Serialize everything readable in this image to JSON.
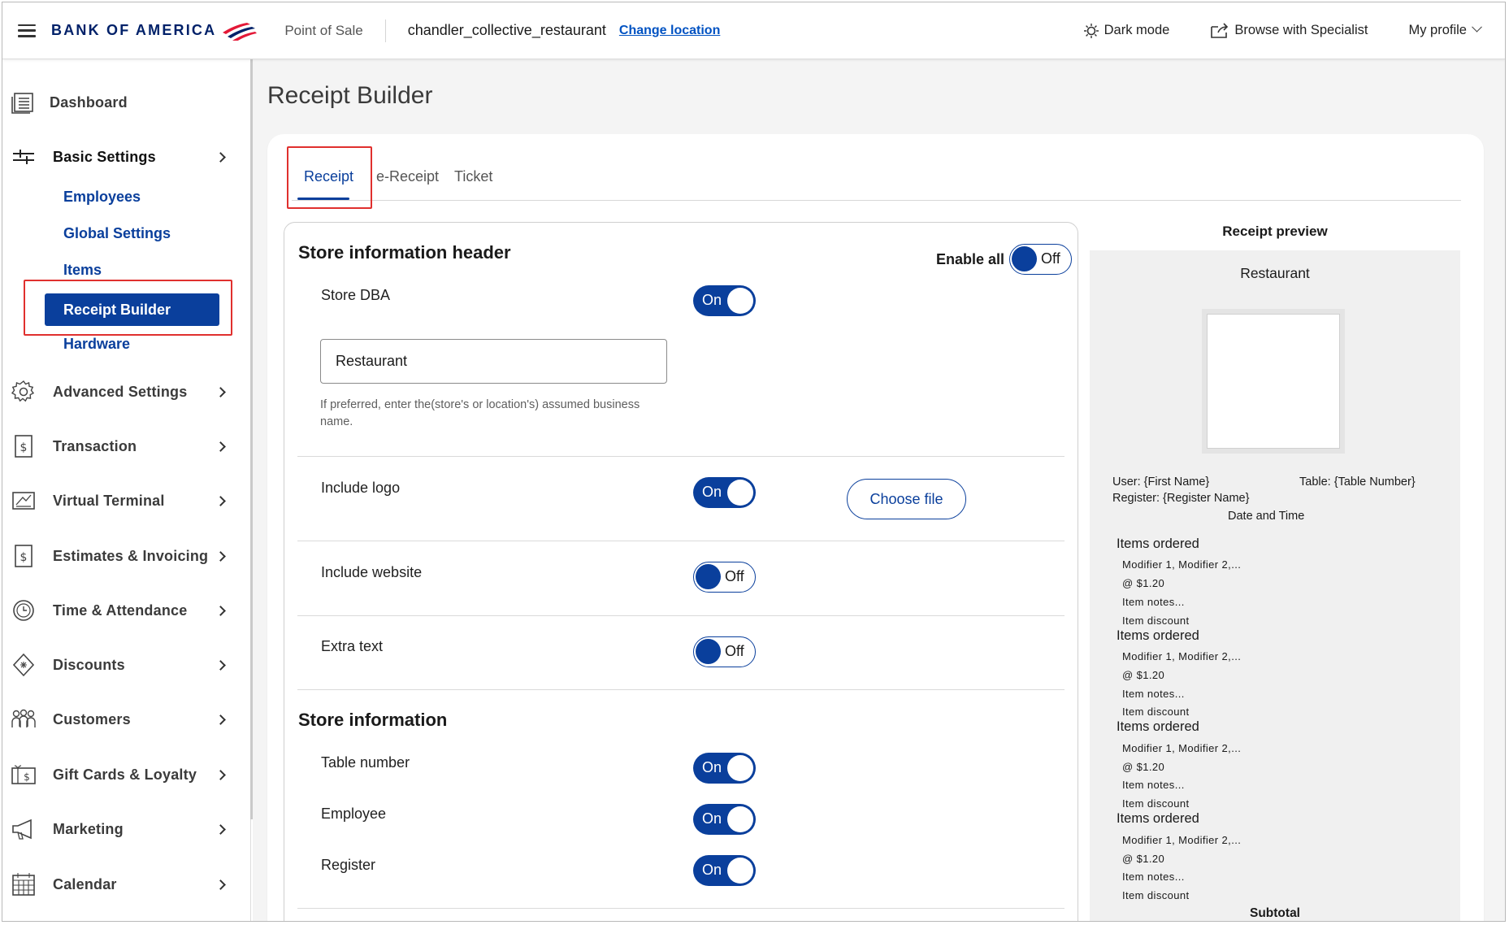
{
  "header": {
    "logo_text": "BANK OF AMERICA",
    "app_label": "Point of Sale",
    "location": "chandler_collective_restaurant",
    "change_location": "Change location",
    "dark_mode": "Dark mode",
    "browse_specialist": "Browse with Specialist",
    "my_profile": "My profile",
    "brand_color": "#012169",
    "accent_color": "#e31837"
  },
  "sidebar": {
    "dashboard": "Dashboard",
    "basic_settings": "Basic Settings",
    "sub_items": {
      "employees": "Employees",
      "global_settings": "Global Settings",
      "items": "Items",
      "receipt_builder": "Receipt Builder",
      "hardware": "Hardware"
    },
    "items": [
      {
        "label": "Advanced Settings",
        "icon": "gear-icon"
      },
      {
        "label": "Transaction",
        "icon": "dollar-doc-icon"
      },
      {
        "label": "Virtual Terminal",
        "icon": "terminal-icon"
      },
      {
        "label": "Estimates & Invoicing",
        "icon": "invoice-icon"
      },
      {
        "label": "Time & Attendance",
        "icon": "clock-icon"
      },
      {
        "label": "Discounts",
        "icon": "tag-icon"
      },
      {
        "label": "Customers",
        "icon": "people-icon"
      },
      {
        "label": "Gift Cards & Loyalty",
        "icon": "gift-card-icon"
      },
      {
        "label": "Marketing",
        "icon": "megaphone-icon"
      },
      {
        "label": "Calendar",
        "icon": "calendar-icon"
      }
    ],
    "active_color": "#0a3f9c"
  },
  "main": {
    "page_title": "Receipt Builder",
    "tabs": [
      {
        "label": "Receipt",
        "active": true
      },
      {
        "label": "e-Receipt",
        "active": false
      },
      {
        "label": "Ticket",
        "active": false
      }
    ]
  },
  "settings": {
    "header_section_title": "Store information header",
    "enable_all_label": "Enable all",
    "enable_all_state": "Off",
    "store_dba": {
      "label": "Store DBA",
      "state": "On",
      "value": "Restaurant",
      "helper": "If preferred, enter the(store's or location's) assumed business name."
    },
    "include_logo": {
      "label": "Include logo",
      "state": "On",
      "button": "Choose file"
    },
    "include_website": {
      "label": "Include website",
      "state": "Off"
    },
    "extra_text": {
      "label": "Extra text",
      "state": "Off"
    },
    "info_section_title": "Store information",
    "table_number": {
      "label": "Table number",
      "state": "On"
    },
    "employee": {
      "label": "Employee",
      "state": "On"
    },
    "register": {
      "label": "Register",
      "state": "On"
    }
  },
  "preview": {
    "title": "Receipt preview",
    "store_name": "Restaurant",
    "user": "User: {First Name}",
    "table": "Table: {Table Number}",
    "register": "Register: {Register Name}",
    "date_time": "Date and Time",
    "items": [
      {
        "name": "Items ordered",
        "modifiers": "Modifier 1, Modifier 2,...",
        "price": "@ $1.20",
        "notes": "Item notes...",
        "discount": "Item discount"
      },
      {
        "name": "Items ordered",
        "modifiers": "Modifier 1, Modifier 2,...",
        "price": "@ $1.20",
        "notes": "Item notes...",
        "discount": "Item discount"
      },
      {
        "name": "Items ordered",
        "modifiers": "Modifier 1, Modifier 2,...",
        "price": "@ $1.20",
        "notes": "Item notes...",
        "discount": "Item discount"
      },
      {
        "name": "Items ordered",
        "modifiers": "Modifier 1, Modifier 2,...",
        "price": "@ $1.20",
        "notes": "Item notes...",
        "discount": "Item discount"
      }
    ],
    "subtotal": "Subtotal"
  }
}
